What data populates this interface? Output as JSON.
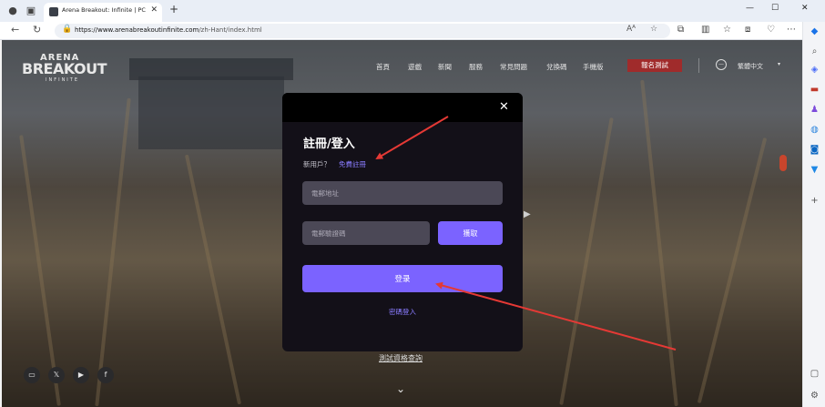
{
  "browser": {
    "tab_title": "Arena Breakout: Infinite | PC STEAM",
    "tab_close": "✕",
    "new_tab": "+",
    "url_host": "https://www.arenabreakoutinfinite.com",
    "url_path": "/zh-Hant/index.html",
    "read_aloud": "Aᴬ",
    "window": {
      "minimize": "—",
      "maximize": "☐",
      "close": "✕"
    }
  },
  "site": {
    "logo": {
      "line1": "ARENA",
      "line2": "BREAKOUT",
      "line3": "INFINITE"
    },
    "nav": [
      "首頁",
      "遊戲",
      "新聞",
      "服務",
      "常見問題",
      "兌換碼",
      "手機版"
    ],
    "register_test": "報名測試",
    "language": "繁體中文",
    "lang_caret": "▾",
    "qualification_check": "測試資格查詢",
    "scroll_down": "⌄"
  },
  "modal": {
    "close": "✕",
    "title": "註冊/登入",
    "new_user": "新用戶？",
    "free_register": "免費註冊",
    "email_placeholder": "電郵地址",
    "code_placeholder": "電郵驗證碼",
    "get_code": "獲取",
    "login": "登录",
    "password_login": "密碼登入"
  },
  "annotations": {
    "color": "#e53935"
  }
}
